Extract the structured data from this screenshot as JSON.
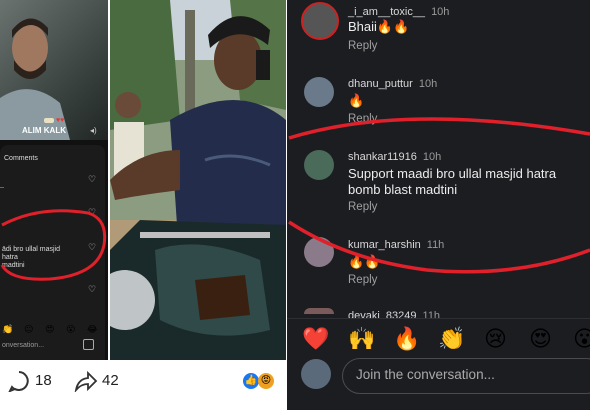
{
  "left_panel": {
    "comments_title": "Comments",
    "partial_comment": "ādi bro ullal masjid hatra\nmadtini",
    "overlay_text": "ALIM KALK",
    "input_placeholder": "onversation..."
  },
  "bottom_bar": {
    "comments_count": "18",
    "shares_count": "42"
  },
  "comments": [
    {
      "user": "_i_am__toxic__",
      "time": "10h",
      "text": "Bhaii🔥🔥",
      "reply": "Reply"
    },
    {
      "user": "dhanu_puttur",
      "time": "10h",
      "text": "🔥",
      "reply": "Reply"
    },
    {
      "user": "shankar11916",
      "time": "10h",
      "text": "Support maadi bro ullal masjid hatra bomb blast madtini",
      "reply": "Reply"
    },
    {
      "user": "kumar_harshin",
      "time": "11h",
      "text": "🔥🔥",
      "reply": "Reply"
    },
    {
      "user": "devaki_83249",
      "time": "11h"
    }
  ],
  "emoji_bar": [
    "❤️",
    "🙌",
    "🔥",
    "👏",
    "😢",
    "😍",
    "😮"
  ],
  "left_emoji_bar": [
    "👏",
    "😐",
    "😍",
    "😮",
    "😂"
  ],
  "join_placeholder": "Join the conversation...",
  "colors": {
    "annotation_red": "#e0202a",
    "dark_bg": "#1c1d21"
  }
}
